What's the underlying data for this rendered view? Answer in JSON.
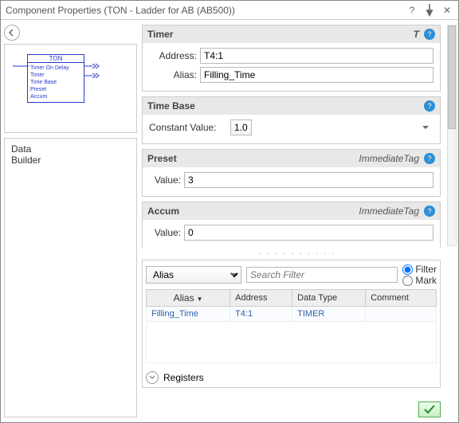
{
  "title": "Component Properties (TON - Ladder for AB (AB500))",
  "preview": {
    "header": "TON",
    "lines": [
      "Timer On Delay",
      "Timer",
      "Time Base",
      "Preset",
      "Accum"
    ]
  },
  "tree": {
    "data": "Data",
    "builder": "Builder"
  },
  "sections": {
    "timer": {
      "title": "Timer",
      "symbol": "T",
      "address_label": "Address:",
      "address": "T4:1",
      "alias_label": "Alias:",
      "alias": "Filling_Time"
    },
    "timebase": {
      "title": "Time Base",
      "cv_label": "Constant Value:",
      "cv": "1.0"
    },
    "preset": {
      "title": "Preset",
      "tag": "ImmediateTag",
      "value_label": "Value:",
      "value": "3"
    },
    "accum": {
      "title": "Accum",
      "tag": "ImmediateTag",
      "value_label": "Value:",
      "value": "0"
    }
  },
  "grid": {
    "dropdown": "Alias",
    "search_placeholder": "Search Filter",
    "filter": "Filter",
    "mark": "Mark",
    "cols": {
      "alias": "Alias",
      "address": "Address",
      "datatype": "Data Type",
      "comment": "Comment"
    },
    "rows": [
      {
        "alias": "Filling_Time",
        "address": "T4:1",
        "datatype": "TIMER",
        "comment": ""
      }
    ]
  },
  "registers": "Registers"
}
